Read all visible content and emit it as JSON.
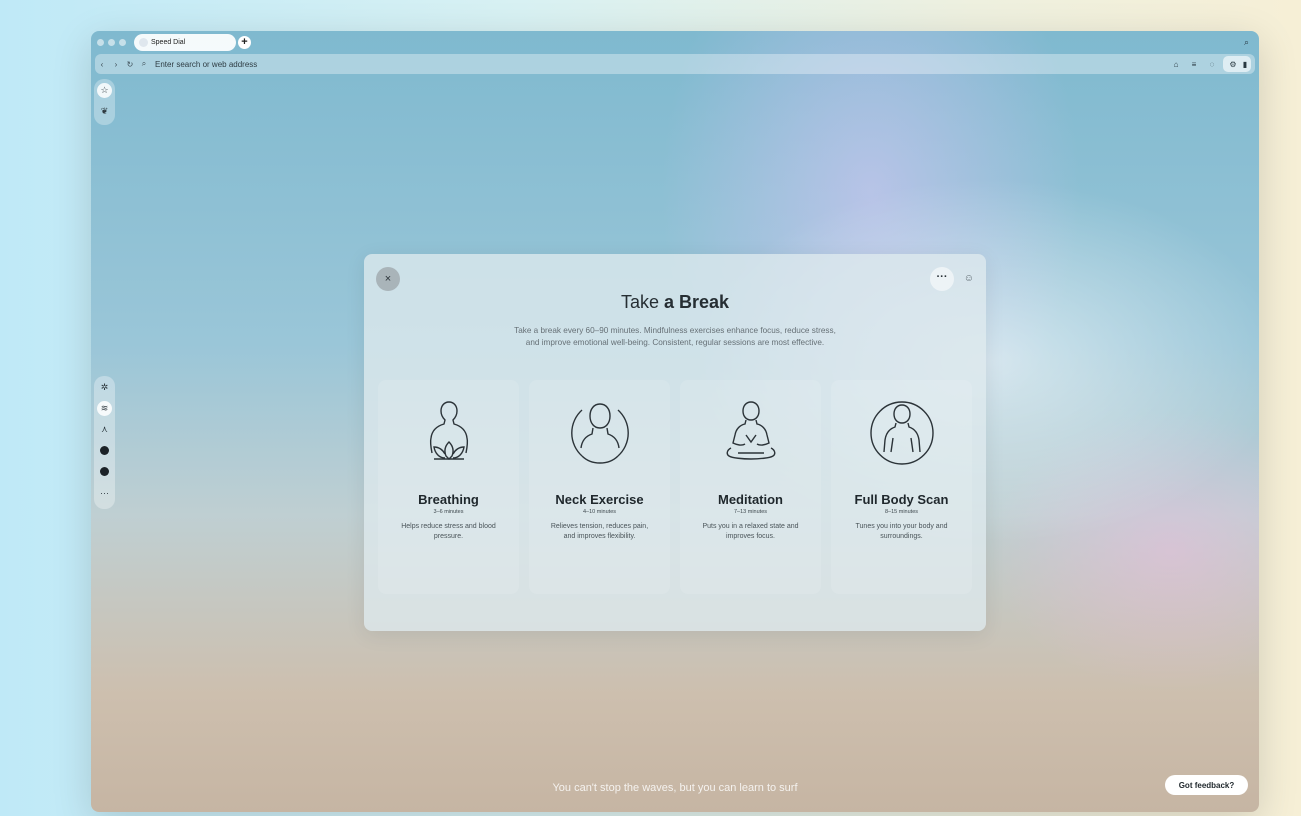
{
  "browser": {
    "tab_title": "Speed Dial",
    "new_tab_label": "+",
    "address_placeholder": "Enter search or web address"
  },
  "modal": {
    "title_prefix": "Take",
    "title_bold": "a Break",
    "description_line1": "Take a break every 60–90 minutes. Mindfulness exercises enhance focus, reduce stress,",
    "description_line2": "and improve emotional well-being. Consistent, regular sessions are most effective.",
    "close_label": "×",
    "more_label": "···",
    "cards": [
      {
        "title": "Breathing",
        "duration": "3–6 minutes",
        "desc_line1": "Helps reduce stress and blood",
        "desc_line2": "pressure.",
        "icon": "lotus-person-icon"
      },
      {
        "title": "Neck Exercise",
        "duration": "4–10 minutes",
        "desc_line1": "Relieves tension, reduces pain,",
        "desc_line2": "and improves flexibility.",
        "icon": "head-circle-icon"
      },
      {
        "title": "Meditation",
        "duration": "7–13 minutes",
        "desc_line1": "Puts you in a relaxed state and",
        "desc_line2": "improves focus.",
        "icon": "meditating-person-icon"
      },
      {
        "title": "Full Body Scan",
        "duration": "8–15 minutes",
        "desc_line1": "Tunes you into your body and",
        "desc_line2": "surroundings.",
        "icon": "body-scan-icon"
      }
    ]
  },
  "footer": {
    "quote": "You can't stop the waves, but you can learn to surf",
    "feedback_label": "Got feedback?"
  }
}
